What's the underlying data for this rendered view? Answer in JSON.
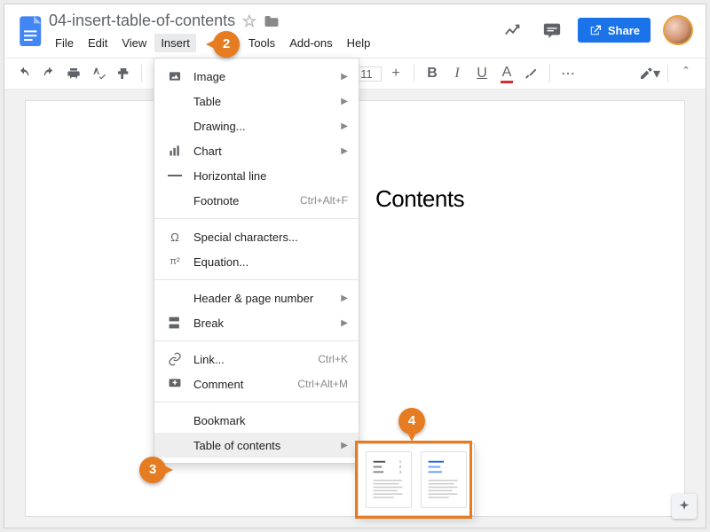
{
  "doc": {
    "title": "04-insert-table-of-contents"
  },
  "menus": {
    "file": "File",
    "edit": "Edit",
    "view": "View",
    "insert": "Insert",
    "tools": "Tools",
    "addons": "Add-ons",
    "help": "Help"
  },
  "share": "Share",
  "toolbar": {
    "font_size": "11"
  },
  "page": {
    "visible_text": "Contents"
  },
  "dropdown": {
    "image": "Image",
    "table": "Table",
    "drawing": "Drawing...",
    "chart": "Chart",
    "hline": "Horizontal line",
    "footnote": {
      "label": "Footnote",
      "shortcut": "Ctrl+Alt+F"
    },
    "special": "Special characters...",
    "equation": "Equation...",
    "header": "Header & page number",
    "break": "Break",
    "link": {
      "label": "Link...",
      "shortcut": "Ctrl+K"
    },
    "comment": {
      "label": "Comment",
      "shortcut": "Ctrl+Alt+M"
    },
    "bookmark": "Bookmark",
    "toc": "Table of contents"
  },
  "callouts": {
    "c2": "2",
    "c3": "3",
    "c4": "4"
  }
}
